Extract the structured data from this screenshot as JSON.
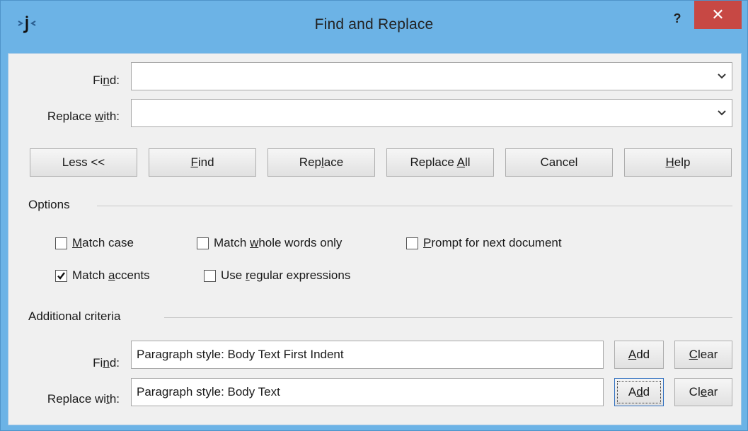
{
  "window": {
    "title": "Find and Replace",
    "help_glyph": "?",
    "close_glyph": "✕",
    "icon": "app-logo-icon"
  },
  "search": {
    "find_label": "Find:",
    "find_value": "",
    "replace_label": "Replace with:",
    "replace_value": ""
  },
  "buttons": {
    "less": "Less <<",
    "find": "Find",
    "replace": "Replace",
    "replace_all": "Replace All",
    "cancel": "Cancel",
    "help": "Help"
  },
  "options": {
    "heading": "Options",
    "match_case": {
      "label": "Match case",
      "checked": false
    },
    "whole_words": {
      "label": "Match whole words only",
      "checked": false
    },
    "prompt_next": {
      "label": "Prompt for next document",
      "checked": false
    },
    "match_accents": {
      "label": "Match accents",
      "checked": true
    },
    "regex": {
      "label": "Use regular expressions",
      "checked": false
    }
  },
  "criteria": {
    "heading": "Additional criteria",
    "find_label": "Find:",
    "find_value": "Paragraph style: Body Text First Indent",
    "replace_label": "Replace with:",
    "replace_value": "Paragraph style: Body Text",
    "add_label": "Add",
    "clear_label": "Clear"
  },
  "colors": {
    "frame": "#6cb3e6",
    "close": "#c74844",
    "client": "#f0f0f0"
  }
}
